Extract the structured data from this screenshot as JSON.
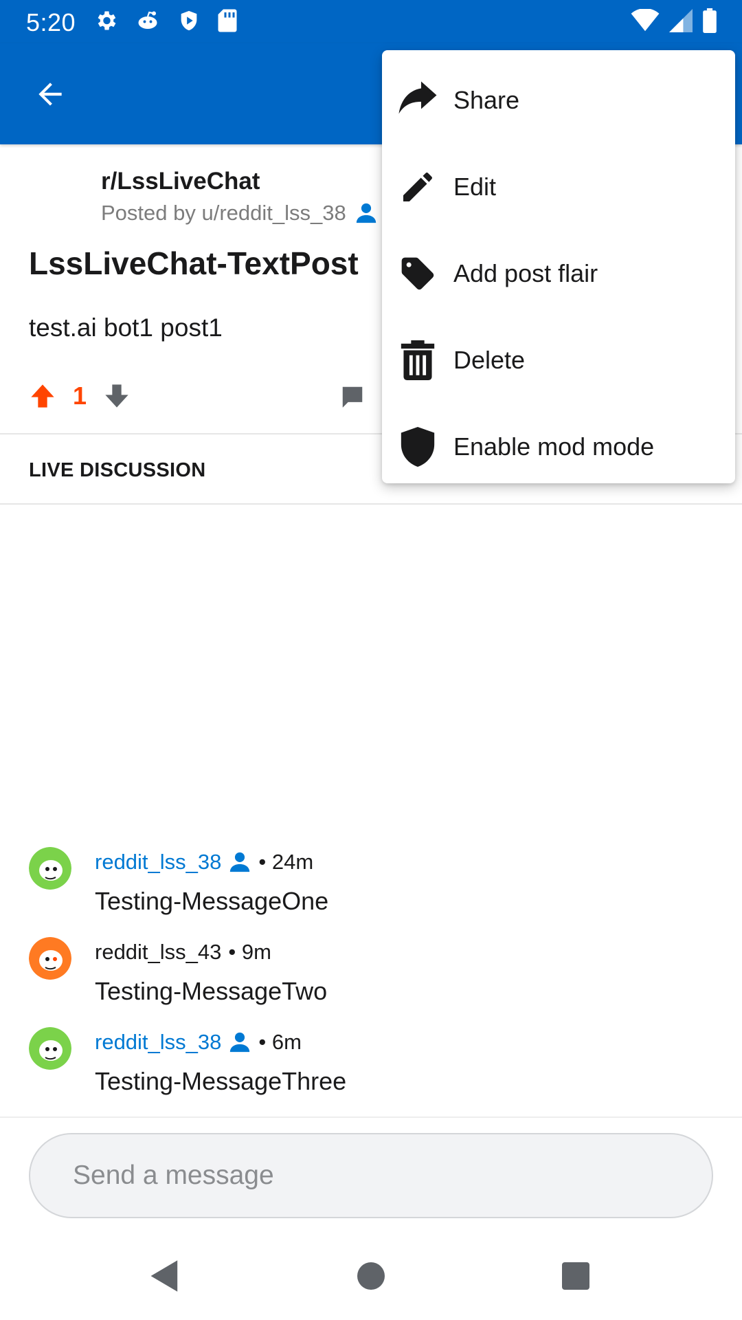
{
  "status_bar": {
    "time": "5:20",
    "left_icons": [
      "gear-icon",
      "reddit-alien-icon",
      "shield-play-icon",
      "sd-card-icon"
    ],
    "right_icons": [
      "wifi-icon",
      "cell-signal-icon",
      "battery-icon"
    ]
  },
  "app_bar": {
    "back_icon": "arrow-back-icon",
    "color": "#0066c4"
  },
  "post": {
    "subreddit": "r/LssLiveChat",
    "posted_by": "Posted by u/reddit_lss_38",
    "title": "LssLiveChat-TextPost",
    "body": "test.ai bot1 post1",
    "score": "1",
    "upvote_color": "#ff4500"
  },
  "section": {
    "live_discussion": "LIVE DISCUSSION"
  },
  "messages": [
    {
      "user": "reddit_lss_38",
      "is_op": true,
      "time": "• 24m",
      "text": "Testing-MessageOne",
      "avatar_color": "#7bd24a"
    },
    {
      "user": "reddit_lss_43",
      "is_op": false,
      "time": "• 9m",
      "text": "Testing-MessageTwo",
      "avatar_color": "#ff7a22"
    },
    {
      "user": "reddit_lss_38",
      "is_op": true,
      "time": "• 6m",
      "text": "Testing-MessageThree",
      "avatar_color": "#7bd24a"
    }
  ],
  "composer": {
    "placeholder": "Send a message"
  },
  "menu": {
    "items": [
      {
        "label": "Share",
        "icon": "share-icon"
      },
      {
        "label": "Edit",
        "icon": "pencil-icon"
      },
      {
        "label": "Add post flair",
        "icon": "tag-icon"
      },
      {
        "label": "Delete",
        "icon": "trash-icon"
      },
      {
        "label": "Enable mod mode",
        "icon": "shield-icon"
      }
    ]
  },
  "nav": {
    "buttons": [
      "back-triangle-icon",
      "home-circle-icon",
      "recents-square-icon"
    ]
  }
}
